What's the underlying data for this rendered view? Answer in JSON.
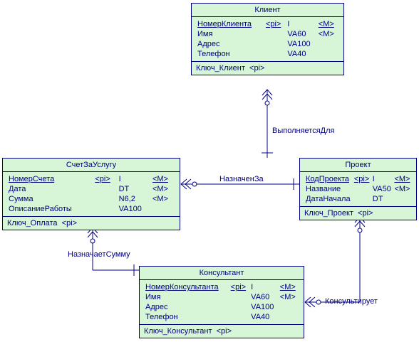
{
  "entities": {
    "client": {
      "title": "Клиент",
      "attrs": [
        {
          "name": "НомерКлиента",
          "pi": "<pi>",
          "type": "I",
          "mand": "<M>",
          "pk": true
        },
        {
          "name": "Имя",
          "pi": "",
          "type": "VA60",
          "mand": "<M>",
          "pk": false
        },
        {
          "name": "Адрес",
          "pi": "",
          "type": "VA100",
          "mand": "",
          "pk": false
        },
        {
          "name": "Телефон",
          "pi": "",
          "type": "VA40",
          "mand": "",
          "pk": false
        }
      ],
      "key": "Ключ_Клиент",
      "keytag": "<pi>"
    },
    "invoice": {
      "title": "СчетЗаУслугу",
      "attrs": [
        {
          "name": "НомерСчета",
          "pi": "<pi>",
          "type": "I",
          "mand": "<M>",
          "pk": true
        },
        {
          "name": "Дата",
          "pi": "",
          "type": "DT",
          "mand": "<M>",
          "pk": false
        },
        {
          "name": "Сумма",
          "pi": "",
          "type": "N6,2",
          "mand": "<M>",
          "pk": false
        },
        {
          "name": "ОписаниеРаботы",
          "pi": "",
          "type": "VA100",
          "mand": "",
          "pk": false
        }
      ],
      "key": "Ключ_Оплата",
      "keytag": "<pi>"
    },
    "project": {
      "title": "Проект",
      "attrs": [
        {
          "name": "КодПроекта",
          "pi": "<pi>",
          "type": "I",
          "mand": "<M>",
          "pk": true
        },
        {
          "name": "Название",
          "pi": "",
          "type": "VA50",
          "mand": "<M>",
          "pk": false
        },
        {
          "name": "ДатаНачала",
          "pi": "",
          "type": "DT",
          "mand": "",
          "pk": false
        }
      ],
      "key": "Ключ_Проект",
      "keytag": "<pi>"
    },
    "consultant": {
      "title": "Консультант",
      "attrs": [
        {
          "name": "НомерКонсультанта",
          "pi": "<pi>",
          "type": "I",
          "mand": "<M>",
          "pk": true
        },
        {
          "name": "Имя",
          "pi": "",
          "type": "VA60",
          "mand": "<M>",
          "pk": false
        },
        {
          "name": "Адрес",
          "pi": "",
          "type": "VA100",
          "mand": "",
          "pk": false
        },
        {
          "name": "Телефон",
          "pi": "",
          "type": "VA40",
          "mand": "",
          "pk": false
        }
      ],
      "key": "Ключ_Консультант",
      "keytag": "<pi>"
    }
  },
  "relationships": {
    "r1": "ВыполняетсяДля",
    "r2": "НазначенЗа",
    "r3": "НазначаетСумму",
    "r4": "Консультирует"
  }
}
